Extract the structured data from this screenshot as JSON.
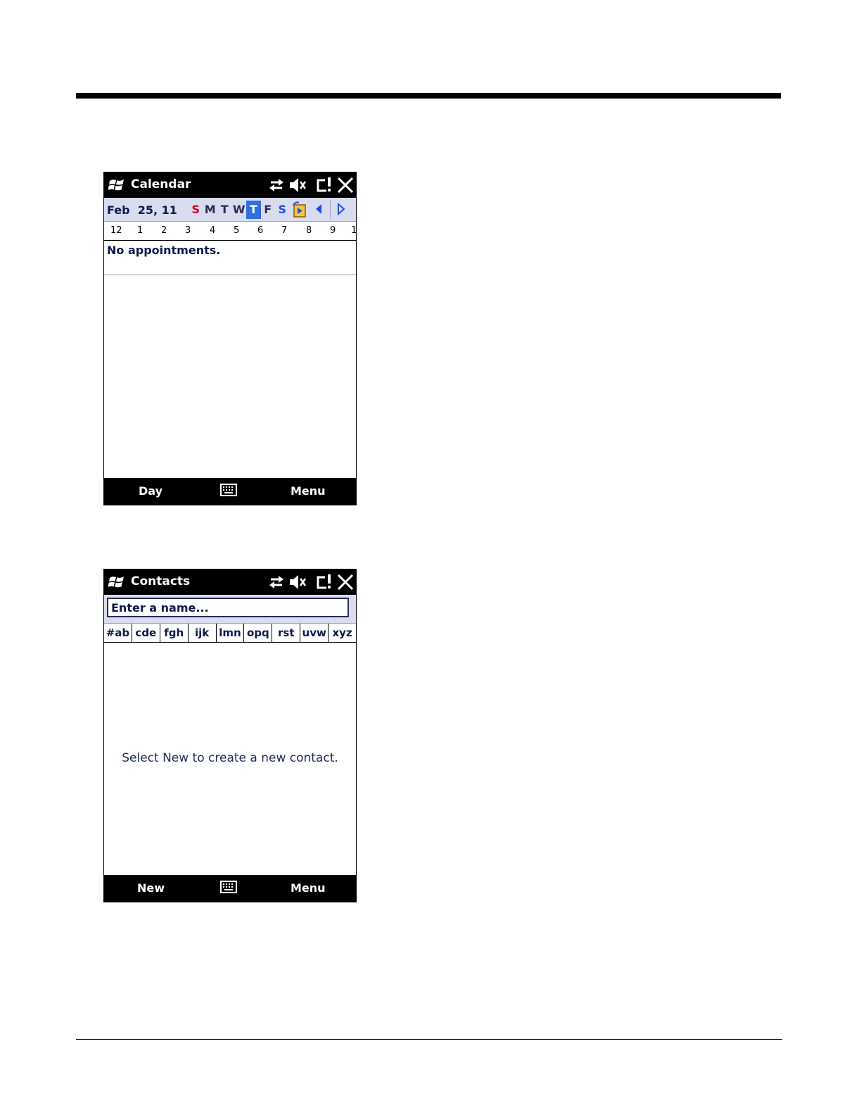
{
  "calendar": {
    "title": "Calendar",
    "date": "Feb  25, 11",
    "weekdays": [
      "S",
      "M",
      "T",
      "W",
      "T",
      "F",
      "S"
    ],
    "selected_day_index": 4,
    "hours": [
      "12",
      "1",
      "2",
      "3",
      "4",
      "5",
      "6",
      "7",
      "8",
      "9",
      "1"
    ],
    "empty_text": "No appointments.",
    "left_softkey": "Day",
    "right_softkey": "Menu"
  },
  "contacts": {
    "title": "Contacts",
    "search_placeholder": "Enter a name...",
    "letter_groups": [
      "#ab",
      "cde",
      "fgh",
      "ijk",
      "lmn",
      "opq",
      "rst",
      "uvw",
      "xyz"
    ],
    "empty_text": "Select New to create a new contact.",
    "left_softkey": "New",
    "right_softkey": "Menu"
  },
  "icons": {
    "start": "windows-logo-icon",
    "connectivity": "connectivity-arrows-icon",
    "volume": "speaker-muted-icon",
    "notification": "notification-icon",
    "close": "close-icon",
    "keyboard": "keyboard-icon",
    "today": "go-to-today-icon",
    "prev": "arrow-left-icon",
    "next": "arrow-right-icon"
  },
  "colors": {
    "titlebar": "#000000",
    "header_bg": "#d9dcef",
    "selected_day": "#2f6fe0",
    "weekend_red": "#e0001a",
    "weekend_blue": "#1e4fd8"
  }
}
